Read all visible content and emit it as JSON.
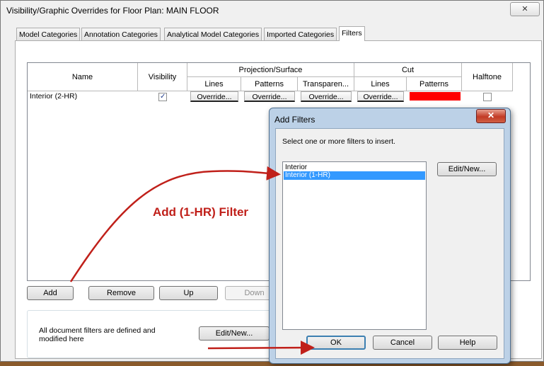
{
  "window": {
    "title": "Visibility/Graphic Overrides for Floor Plan: MAIN FLOOR",
    "close_glyph": "✕"
  },
  "tabs": [
    {
      "label": "Model Categories",
      "active": false
    },
    {
      "label": "Annotation Categories",
      "active": false
    },
    {
      "label": "Analytical Model Categories",
      "active": false
    },
    {
      "label": "Imported Categories",
      "active": false
    },
    {
      "label": "Filters",
      "active": true
    }
  ],
  "grid": {
    "headers": {
      "name": "Name",
      "visibility": "Visibility",
      "projection": "Projection/Surface",
      "cut": "Cut",
      "halftone": "Halftone",
      "lines": "Lines",
      "patterns": "Patterns",
      "transparency": "Transparen...",
      "cut_lines": "Lines",
      "cut_patterns": "Patterns"
    },
    "rows": [
      {
        "name": "Interior (2-HR)",
        "visible": true,
        "proj_lines": "Override...",
        "proj_patterns": "Override...",
        "transparency": "Override...",
        "cut_lines": "Override...",
        "cut_pattern_color": "#ff0000",
        "halftone": false
      }
    ]
  },
  "buttons": {
    "add": "Add",
    "remove": "Remove",
    "up": "Up",
    "down": "Down"
  },
  "group": {
    "description": "All document filters are defined and modified here",
    "edit_new": "Edit/New..."
  },
  "add_filters_dialog": {
    "title": "Add Filters",
    "close_glyph": "✕",
    "instruction": "Select one or more filters to insert.",
    "filters": [
      {
        "label": "Interior",
        "selected": false
      },
      {
        "label": "Interior (1-HR)",
        "selected": true
      }
    ],
    "edit_new": "Edit/New...",
    "ok": "OK",
    "cancel": "Cancel",
    "help": "Help"
  },
  "annotation": {
    "text": "Add (1-HR) Filter",
    "color": "#c0201a"
  },
  "colors": {
    "selection": "#3399ff",
    "dialog_frame": "#bcd1e7",
    "background_wood": "#8a5a2b"
  }
}
